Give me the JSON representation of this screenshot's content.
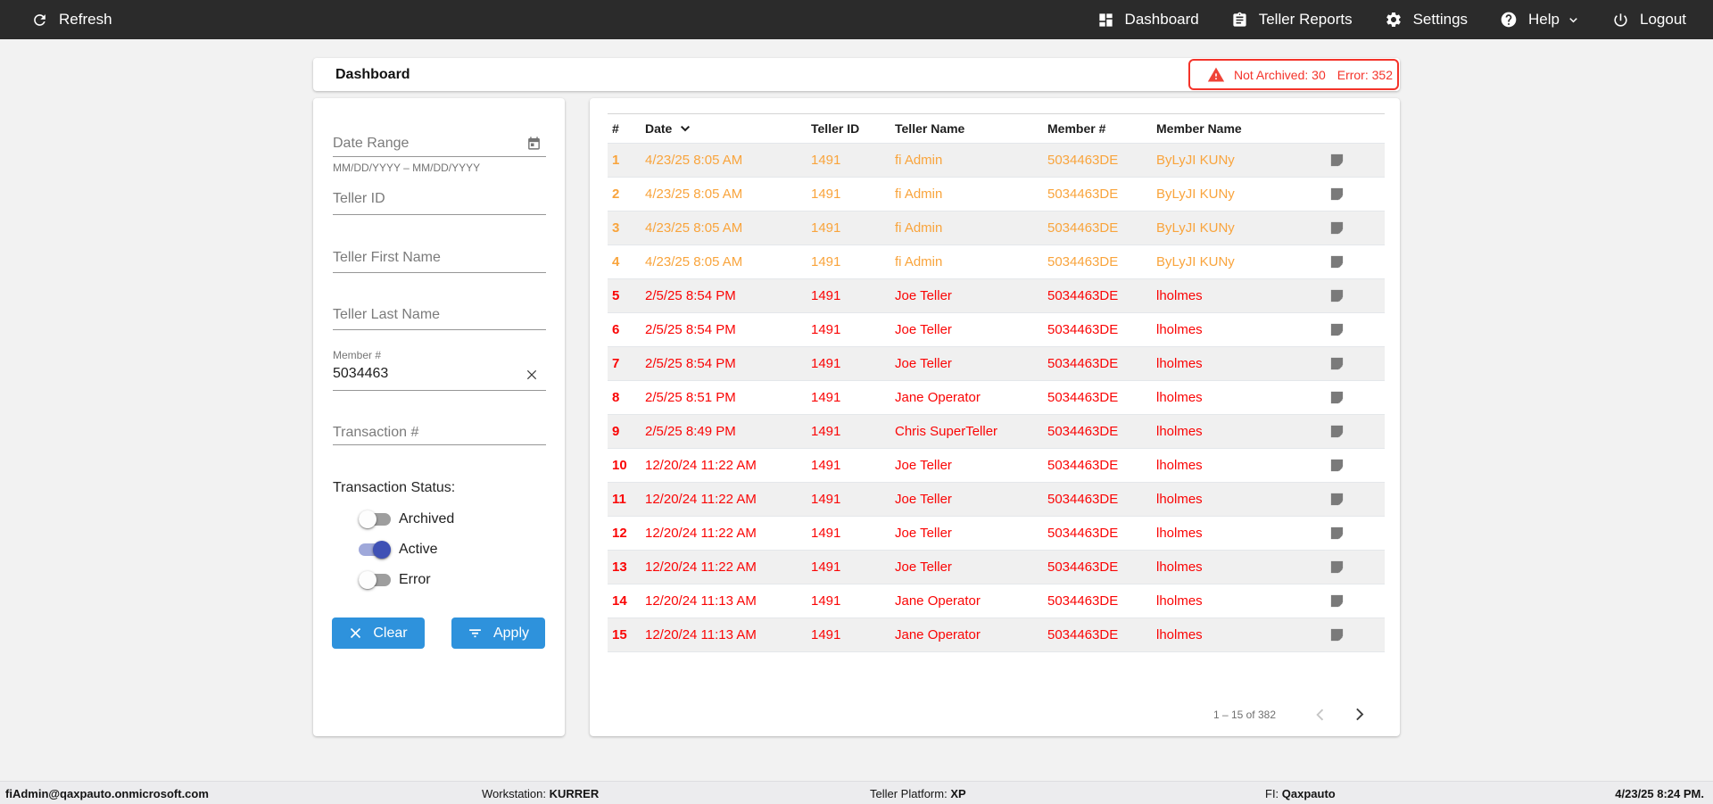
{
  "topbar": {
    "refresh_label": "Refresh",
    "nav": [
      {
        "label": "Dashboard"
      },
      {
        "label": "Teller Reports"
      },
      {
        "label": "Settings"
      },
      {
        "label": "Help"
      },
      {
        "label": "Logout"
      }
    ]
  },
  "page": {
    "title": "Dashboard"
  },
  "alert": {
    "not_archived": "Not Archived: 30",
    "error": "Error: 352"
  },
  "filters": {
    "date_range": {
      "placeholder": "Date Range",
      "hint": "MM/DD/YYYY – MM/DD/YYYY"
    },
    "teller_id": {
      "placeholder": "Teller ID"
    },
    "teller_first_name": {
      "placeholder": "Teller First Name"
    },
    "teller_last_name": {
      "placeholder": "Teller Last Name"
    },
    "member_number": {
      "label": "Member #",
      "value": "5034463"
    },
    "transaction_number": {
      "placeholder": "Transaction #"
    },
    "status": {
      "label": "Transaction Status:",
      "toggles": [
        {
          "label": "Archived",
          "on": false
        },
        {
          "label": "Active",
          "on": true
        },
        {
          "label": "Error",
          "on": false
        }
      ]
    },
    "clear_label": "Clear",
    "apply_label": "Apply"
  },
  "table": {
    "columns": [
      "#",
      "Date",
      "Teller ID",
      "Teller Name",
      "Member #",
      "Member Name"
    ],
    "sorted_column": "Date",
    "rows": [
      {
        "num": "1",
        "date": "4/23/25 8:05 AM",
        "teller_id": "1491",
        "teller_name": "fi Admin",
        "member_number": "5034463DE",
        "member_name": "ByLyJI KUNy",
        "status": "warning"
      },
      {
        "num": "2",
        "date": "4/23/25 8:05 AM",
        "teller_id": "1491",
        "teller_name": "fi Admin",
        "member_number": "5034463DE",
        "member_name": "ByLyJI KUNy",
        "status": "warning"
      },
      {
        "num": "3",
        "date": "4/23/25 8:05 AM",
        "teller_id": "1491",
        "teller_name": "fi Admin",
        "member_number": "5034463DE",
        "member_name": "ByLyJI KUNy",
        "status": "warning"
      },
      {
        "num": "4",
        "date": "4/23/25 8:05 AM",
        "teller_id": "1491",
        "teller_name": "fi Admin",
        "member_number": "5034463DE",
        "member_name": "ByLyJI KUNy",
        "status": "warning"
      },
      {
        "num": "5",
        "date": "2/5/25 8:54 PM",
        "teller_id": "1491",
        "teller_name": "Joe Teller",
        "member_number": "5034463DE",
        "member_name": "lholmes",
        "status": "error"
      },
      {
        "num": "6",
        "date": "2/5/25 8:54 PM",
        "teller_id": "1491",
        "teller_name": "Joe Teller",
        "member_number": "5034463DE",
        "member_name": "lholmes",
        "status": "error"
      },
      {
        "num": "7",
        "date": "2/5/25 8:54 PM",
        "teller_id": "1491",
        "teller_name": "Joe Teller",
        "member_number": "5034463DE",
        "member_name": "lholmes",
        "status": "error"
      },
      {
        "num": "8",
        "date": "2/5/25 8:51 PM",
        "teller_id": "1491",
        "teller_name": "Jane Operator",
        "member_number": "5034463DE",
        "member_name": "lholmes",
        "status": "error"
      },
      {
        "num": "9",
        "date": "2/5/25 8:49 PM",
        "teller_id": "1491",
        "teller_name": "Chris SuperTeller",
        "member_number": "5034463DE",
        "member_name": "lholmes",
        "status": "error"
      },
      {
        "num": "10",
        "date": "12/20/24 11:22 AM",
        "teller_id": "1491",
        "teller_name": "Joe Teller",
        "member_number": "5034463DE",
        "member_name": "lholmes",
        "status": "error"
      },
      {
        "num": "11",
        "date": "12/20/24 11:22 AM",
        "teller_id": "1491",
        "teller_name": "Joe Teller",
        "member_number": "5034463DE",
        "member_name": "lholmes",
        "status": "error"
      },
      {
        "num": "12",
        "date": "12/20/24 11:22 AM",
        "teller_id": "1491",
        "teller_name": "Joe Teller",
        "member_number": "5034463DE",
        "member_name": "lholmes",
        "status": "error"
      },
      {
        "num": "13",
        "date": "12/20/24 11:22 AM",
        "teller_id": "1491",
        "teller_name": "Joe Teller",
        "member_number": "5034463DE",
        "member_name": "lholmes",
        "status": "error"
      },
      {
        "num": "14",
        "date": "12/20/24 11:13 AM",
        "teller_id": "1491",
        "teller_name": "Jane Operator",
        "member_number": "5034463DE",
        "member_name": "lholmes",
        "status": "error"
      },
      {
        "num": "15",
        "date": "12/20/24 11:13 AM",
        "teller_id": "1491",
        "teller_name": "Jane Operator",
        "member_number": "5034463DE",
        "member_name": "lholmes",
        "status": "error"
      }
    ],
    "pagination": {
      "range_label": "1 – 15 of 382"
    }
  },
  "footer": {
    "user": "fiAdmin@qaxpauto.onmicrosoft.com",
    "workstation_label": "Workstation: ",
    "workstation": "KURRER",
    "platform_label": "Teller Platform: ",
    "platform": "XP",
    "fi_label": "FI: ",
    "fi": "Qaxpauto",
    "datetime": "4/23/25 8:24 PM."
  },
  "colors": {
    "topbar_bg": "#2b2b2b",
    "accent_blue": "#2e92dc",
    "warning_orange": "#f9a43c",
    "error_red": "#fa0505",
    "alert_red": "#f4332a",
    "toggle_on_thumb": "#3f51b5",
    "toggle_on_track": "#9fa8da"
  }
}
